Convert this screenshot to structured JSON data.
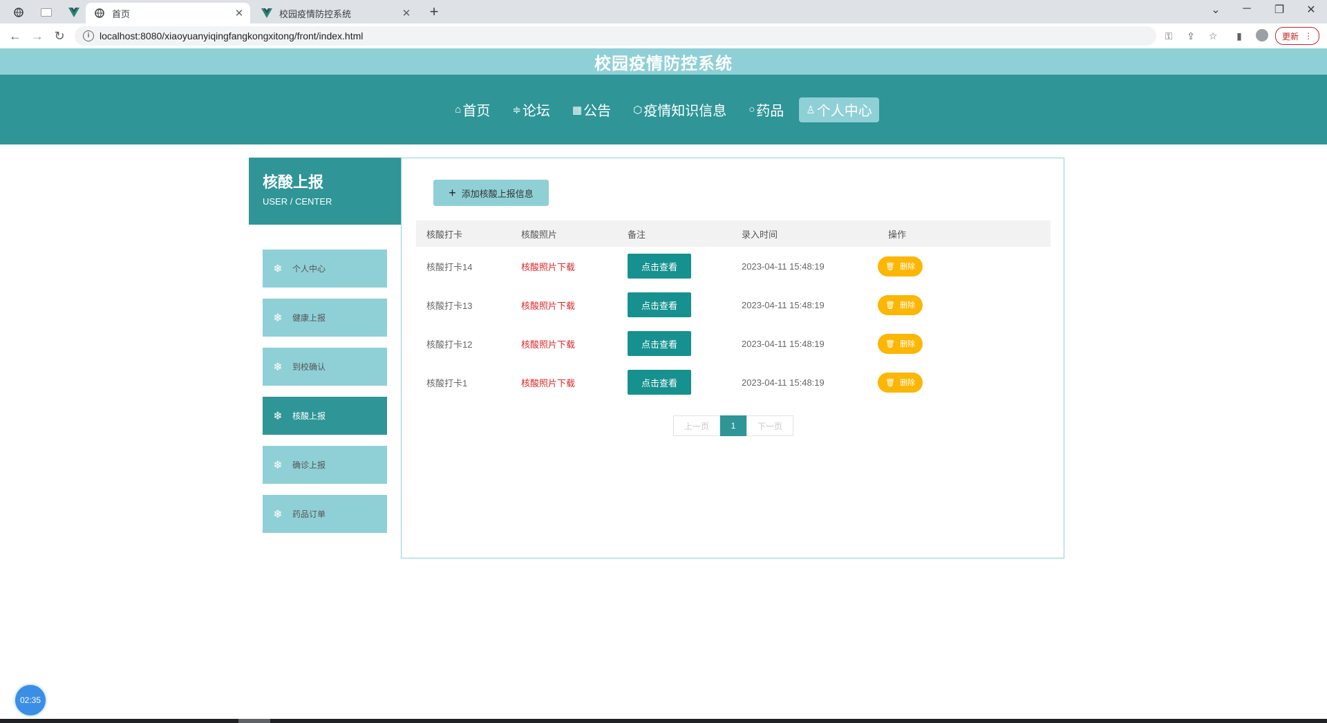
{
  "browser": {
    "tabs": [
      {
        "title": "首页",
        "active": true
      },
      {
        "title": "校园疫情防控系统",
        "active": false
      }
    ],
    "url": "localhost:8080/xiaoyuanyiqingfangkongxitong/front/index.html",
    "update_label": "更新"
  },
  "site": {
    "title": "校园疫情防控系统",
    "nav": [
      {
        "icon": "⌂",
        "label": "首页",
        "active": false
      },
      {
        "icon": "≑",
        "label": "论坛",
        "active": false
      },
      {
        "icon": "▦",
        "label": "公告",
        "active": false
      },
      {
        "icon": "⬡",
        "label": "疫情知识信息",
        "active": false
      },
      {
        "icon": "○",
        "label": "药品",
        "active": false
      },
      {
        "icon": "♙",
        "label": "个人中心",
        "active": true
      }
    ]
  },
  "sidebar": {
    "title": "核酸上报",
    "subtitle": "USER / CENTER",
    "items": [
      {
        "label": "个人中心",
        "active": false
      },
      {
        "label": "健康上报",
        "active": false
      },
      {
        "label": "到校确认",
        "active": false
      },
      {
        "label": "核酸上报",
        "active": true
      },
      {
        "label": "确诊上报",
        "active": false
      },
      {
        "label": "药品订单",
        "active": false
      }
    ]
  },
  "main": {
    "add_button": "添加核酸上报信息",
    "columns": [
      "核酸打卡",
      "核酸照片",
      "备注",
      "录入时间",
      "操作"
    ],
    "rows": [
      {
        "checkin": "核酸打卡14",
        "photo": "核酸照片下载",
        "remark": "点击查看",
        "time": "2023-04-11 15:48:19",
        "action": "删除"
      },
      {
        "checkin": "核酸打卡13",
        "photo": "核酸照片下载",
        "remark": "点击查看",
        "time": "2023-04-11 15:48:19",
        "action": "删除"
      },
      {
        "checkin": "核酸打卡12",
        "photo": "核酸照片下载",
        "remark": "点击查看",
        "time": "2023-04-11 15:48:19",
        "action": "删除"
      },
      {
        "checkin": "核酸打卡1",
        "photo": "核酸照片下载",
        "remark": "点击查看",
        "time": "2023-04-11 15:48:19",
        "action": "删除"
      }
    ],
    "pager": {
      "prev": "上一页",
      "current": "1",
      "next": "下一页"
    }
  },
  "timer": "02:35",
  "colors": {
    "primary": "#2f9597",
    "light": "#8fd0d6",
    "view_button": "#16918f",
    "delete_button": "#fcb604",
    "download_link": "#d9282b"
  }
}
